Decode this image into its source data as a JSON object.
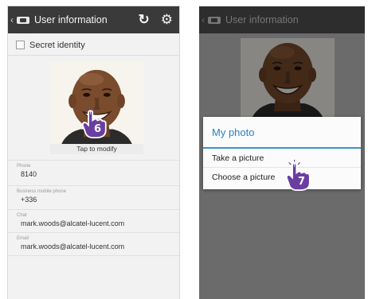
{
  "colors": {
    "actionbar": "#3a3a3a",
    "dialog_accent": "#2a82c2",
    "step_badge": "#6a3ea1"
  },
  "left_screen": {
    "header": {
      "back_icon": "chevron-left-icon",
      "app_icon": "contact-card-icon",
      "title": "User information",
      "refresh_icon": "refresh-icon",
      "settings_icon": "gear-icon"
    },
    "secret_identity": {
      "label": "Secret identity",
      "checked": false
    },
    "photo": {
      "caption": "Tap to modify"
    },
    "fields": [
      {
        "label": "Phone",
        "value": "8140"
      },
      {
        "label": "Business mobile phone",
        "value": "+336"
      },
      {
        "label": "Chat",
        "value": "mark.woods@alcatel-lucent.com"
      },
      {
        "label": "Email",
        "value": "mark.woods@alcatel-lucent.com"
      }
    ],
    "step_badge": "6"
  },
  "right_screen": {
    "header": {
      "title": "User information"
    },
    "dialog": {
      "title": "My photo",
      "items": [
        "Take a picture",
        "Choose a picture"
      ]
    },
    "step_badge": "7"
  }
}
